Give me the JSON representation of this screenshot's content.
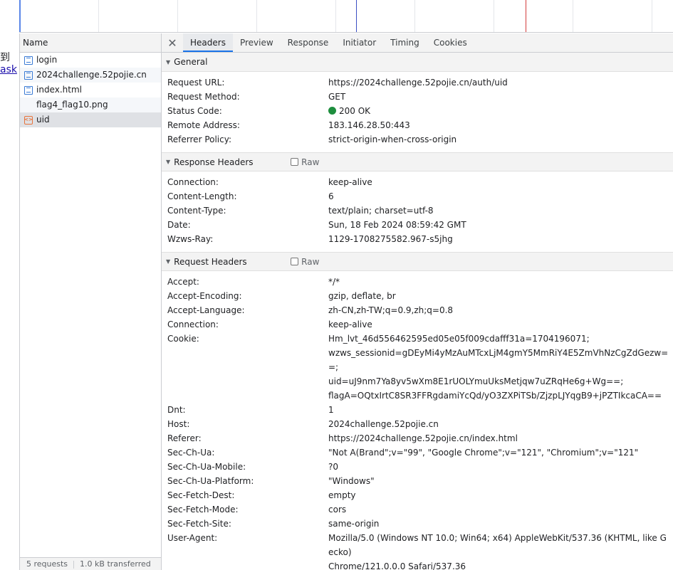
{
  "page_fragment": {
    "line1": "到",
    "line2": "ask"
  },
  "request_list": {
    "column_header": "Name",
    "items": [
      {
        "name": "login",
        "icon": "document-icon"
      },
      {
        "name": "2024challenge.52pojie.cn",
        "icon": "document-icon"
      },
      {
        "name": "index.html",
        "icon": "document-icon"
      },
      {
        "name": "flag4_flag10.png",
        "icon": "image-icon"
      },
      {
        "name": "uid",
        "icon": "xhr-icon"
      }
    ],
    "footer": {
      "requests": "5 requests",
      "transferred": "1.0 kB transferred"
    }
  },
  "detail": {
    "close_symbol": "✕",
    "tabs": [
      "Headers",
      "Preview",
      "Response",
      "Initiator",
      "Timing",
      "Cookies"
    ],
    "active_tab": "Headers",
    "raw_label": "Raw",
    "general": {
      "title": "General",
      "rows": [
        {
          "k": "Request URL:",
          "v": "https://2024challenge.52pojie.cn/auth/uid"
        },
        {
          "k": "Request Method:",
          "v": "GET"
        },
        {
          "k": "Status Code:",
          "v": "200 OK"
        },
        {
          "k": "Remote Address:",
          "v": "183.146.28.50:443"
        },
        {
          "k": "Referrer Policy:",
          "v": "strict-origin-when-cross-origin"
        }
      ]
    },
    "response_headers": {
      "title": "Response Headers",
      "rows": [
        {
          "k": "Connection:",
          "v": "keep-alive"
        },
        {
          "k": "Content-Length:",
          "v": "6"
        },
        {
          "k": "Content-Type:",
          "v": "text/plain; charset=utf-8"
        },
        {
          "k": "Date:",
          "v": "Sun, 18 Feb 2024 08:59:42 GMT"
        },
        {
          "k": "Wzws-Ray:",
          "v": "1129-1708275582.967-s5jhg"
        }
      ]
    },
    "request_headers": {
      "title": "Request Headers",
      "rows": [
        {
          "k": "Accept:",
          "v": "*/*"
        },
        {
          "k": "Accept-Encoding:",
          "v": "gzip, deflate, br"
        },
        {
          "k": "Accept-Language:",
          "v": "zh-CN,zh-TW;q=0.9,zh;q=0.8"
        },
        {
          "k": "Connection:",
          "v": "keep-alive"
        },
        {
          "k": "Cookie:",
          "lines": [
            "Hm_lvt_46d556462595ed05e05f009cdafff31a=1704196071;",
            "wzws_sessionid=gDEyMi4yMzAuMTcxLjM4gmY5MmRiY4E5ZmVhNzCgZdGezw==;",
            "uid=uJ9nm7Ya8yv5wXm8E1rUOLYmuUksMetjqw7uZRqHe6g+Wg==;",
            "flagA=OQtxIrtC8SR3FFRgdamiYcQd/yO3ZXPiTSb/ZjzpLJYqgB9+jPZTIkcaCA=="
          ]
        },
        {
          "k": "Dnt:",
          "v": "1"
        },
        {
          "k": "Host:",
          "v": "2024challenge.52pojie.cn"
        },
        {
          "k": "Referer:",
          "v": "https://2024challenge.52pojie.cn/index.html"
        },
        {
          "k": "Sec-Ch-Ua:",
          "v": "\"Not A(Brand\";v=\"99\", \"Google Chrome\";v=\"121\", \"Chromium\";v=\"121\""
        },
        {
          "k": "Sec-Ch-Ua-Mobile:",
          "v": "?0"
        },
        {
          "k": "Sec-Ch-Ua-Platform:",
          "v": "\"Windows\""
        },
        {
          "k": "Sec-Fetch-Dest:",
          "v": "empty"
        },
        {
          "k": "Sec-Fetch-Mode:",
          "v": "cors"
        },
        {
          "k": "Sec-Fetch-Site:",
          "v": "same-origin"
        },
        {
          "k": "User-Agent:",
          "lines": [
            "Mozilla/5.0 (Windows NT 10.0; Win64; x64) AppleWebKit/537.36 (KHTML, like Gecko)",
            "Chrome/121.0.0.0 Safari/537.36"
          ]
        }
      ]
    }
  },
  "colors": {
    "accent": "#1a73e8",
    "status_ok": "#1e8e3e",
    "xhr": "#e8733a",
    "doc": "#3a7bd5"
  }
}
